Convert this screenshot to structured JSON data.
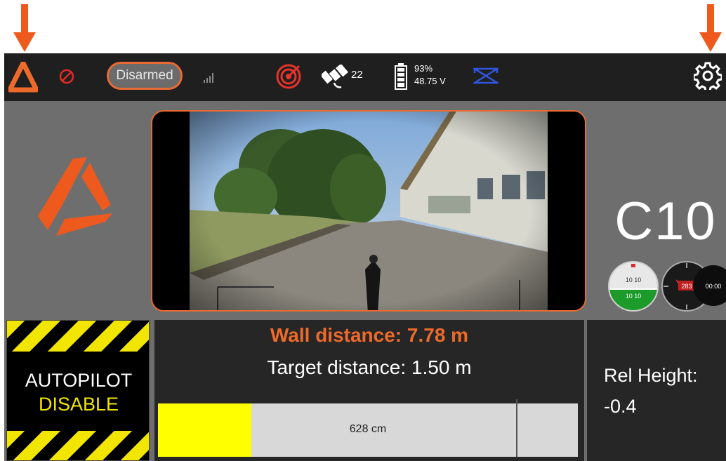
{
  "toolbar": {
    "arm_status": "Disarmed",
    "satellite_count": "22",
    "battery_percent": "93%",
    "battery_voltage": "48.75 V",
    "icons": [
      "app-logo-icon",
      "no-entry-icon",
      "signal-bars-icon",
      "compass-target-icon",
      "satellite-icon",
      "battery-icon",
      "mode-icon",
      "gear-icon"
    ]
  },
  "vehicle": {
    "name": "C10"
  },
  "instruments": {
    "attitude_readout_top": "10 10",
    "attitude_readout_bottom": "10 10",
    "compass_heading": "283",
    "timer": "00:00"
  },
  "autopilot": {
    "line1": "AUTOPILOT",
    "line2": "DISABLE"
  },
  "distance": {
    "wall": "Wall distance: 7.78 m",
    "target": "Target distance: 1.50 m",
    "bar_label": "628 cm",
    "bar_fill_fraction": 0.223,
    "marker_fraction": 0.853
  },
  "height": {
    "label": "Rel Height:",
    "value": "-0.4"
  },
  "colors": {
    "accent": "#ee6a2b",
    "hazard_yellow": "#f2e600",
    "bar_fill": "#ffff00",
    "toolbar": "#1f1f1f",
    "panel": "#262626",
    "background": "#6e6e6e"
  }
}
